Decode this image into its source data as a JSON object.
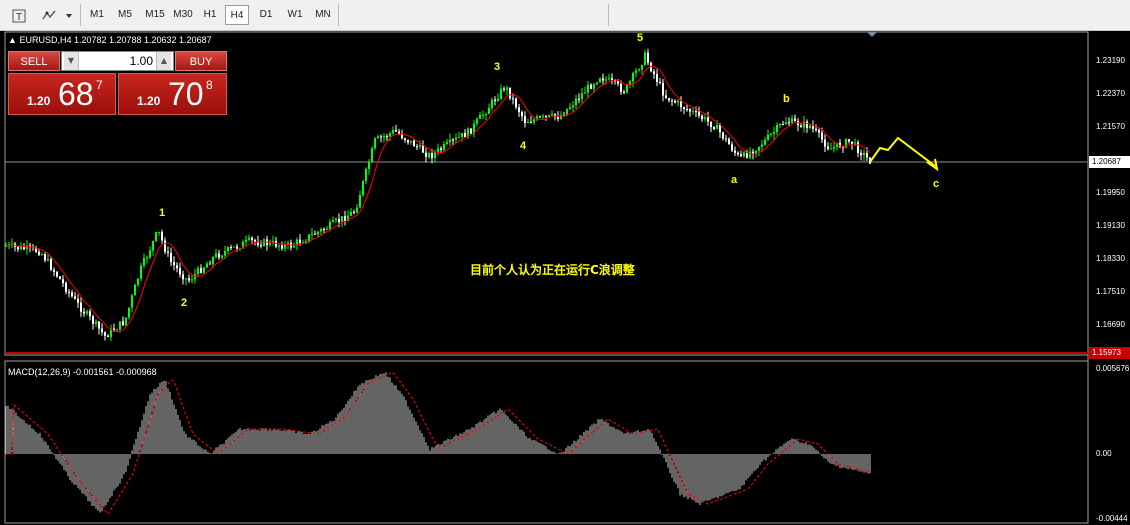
{
  "toolbar": {
    "icons": [
      "text-tool-icon",
      "shapes-tool-icon",
      "dropdown-arrow-icon"
    ],
    "timeframes": [
      "M1",
      "M5",
      "M15",
      "M30",
      "H1",
      "H4",
      "D1",
      "W1",
      "MN"
    ],
    "active_timeframe": "H4"
  },
  "chart": {
    "symbol_line": "EURUSD,H4  1.20782 1.20788 1.20632 1.20687",
    "y_axis_labels": [
      "1.23190",
      "1.22370",
      "1.21570",
      "1.20687",
      "1.19950",
      "1.19130",
      "1.18330",
      "1.17510",
      "1.16690"
    ],
    "current_price": "1.20687",
    "low_price_tag": "1.15973",
    "note": "目前个人认为正在运行C浪调整",
    "wave_labels": [
      "1",
      "2",
      "3",
      "4",
      "5",
      "a",
      "b",
      "a",
      "c"
    ],
    "colors": {
      "bull": "#00ff00",
      "bear": "#ffffff",
      "ma": "#ff0000",
      "annotation": "#ffff00",
      "macd_signal": "#ff0000"
    }
  },
  "trade_panel": {
    "sell_label": "SELL",
    "buy_label": "BUY",
    "lot_value": "1.00",
    "sell_prefix": "1.20",
    "sell_big": "68",
    "sell_sup": "7",
    "buy_prefix": "1.20",
    "buy_big": "70",
    "buy_sup": "8"
  },
  "macd": {
    "label": "MACD(12,26,9) -0.001561 -0.000968",
    "y_axis_labels": [
      "0.005676",
      "0.00",
      "-0.00444"
    ]
  }
}
